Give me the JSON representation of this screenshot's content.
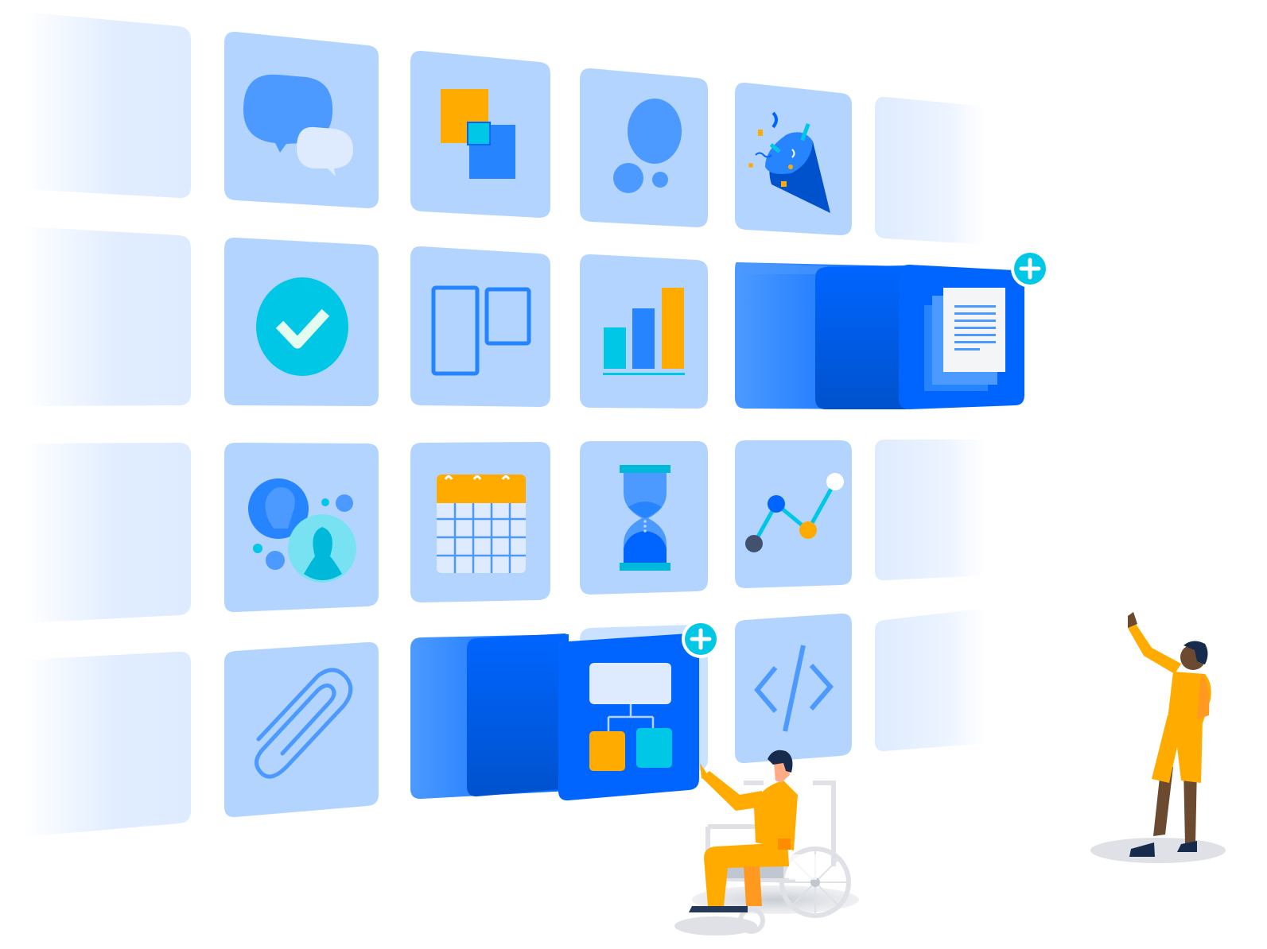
{
  "scene": {
    "description_free": true,
    "palette": {
      "tile": "#b3d4ff",
      "tile_ghost": "#deebff",
      "blue_primary": "#0065ff",
      "blue_mid": "#4c9aff",
      "blue_light": "#79b8ff",
      "teal": "#00c7e6",
      "orange": "#ffab00",
      "navy": "#253858",
      "white": "#ffffff"
    },
    "tiles": [
      {
        "id": "chat",
        "icon": "chat-bubbles-icon",
        "clickable": true
      },
      {
        "id": "squares",
        "icon": "overlapping-squares-icon",
        "clickable": true
      },
      {
        "id": "bubbles",
        "icon": "bubbles-icon",
        "clickable": true
      },
      {
        "id": "party",
        "icon": "party-popper-icon",
        "clickable": true
      },
      {
        "id": "check",
        "icon": "checkmark-circle-icon",
        "clickable": true
      },
      {
        "id": "board",
        "icon": "board-columns-icon",
        "clickable": true
      },
      {
        "id": "bar-chart",
        "icon": "bar-chart-icon",
        "clickable": true
      },
      {
        "id": "document",
        "icon": "document-icon",
        "clickable": true
      },
      {
        "id": "people",
        "icon": "people-icon",
        "clickable": true
      },
      {
        "id": "calendar",
        "icon": "calendar-icon",
        "clickable": true
      },
      {
        "id": "hourglass",
        "icon": "hourglass-icon",
        "clickable": true
      },
      {
        "id": "line-chart",
        "icon": "line-chart-icon",
        "clickable": true
      },
      {
        "id": "paperclip",
        "icon": "paperclip-icon",
        "clickable": true
      },
      {
        "id": "flowchart",
        "icon": "flowchart-icon",
        "clickable": true
      },
      {
        "id": "code",
        "icon": "code-icon",
        "clickable": true
      }
    ],
    "add_buttons": [
      {
        "icon": "plus-icon",
        "target": "document"
      },
      {
        "icon": "plus-icon",
        "target": "flowchart"
      }
    ],
    "figures": [
      {
        "id": "wheelchair-user",
        "icon": "wheelchair-person-icon"
      },
      {
        "id": "standing-person",
        "icon": "pointing-person-icon"
      }
    ]
  }
}
